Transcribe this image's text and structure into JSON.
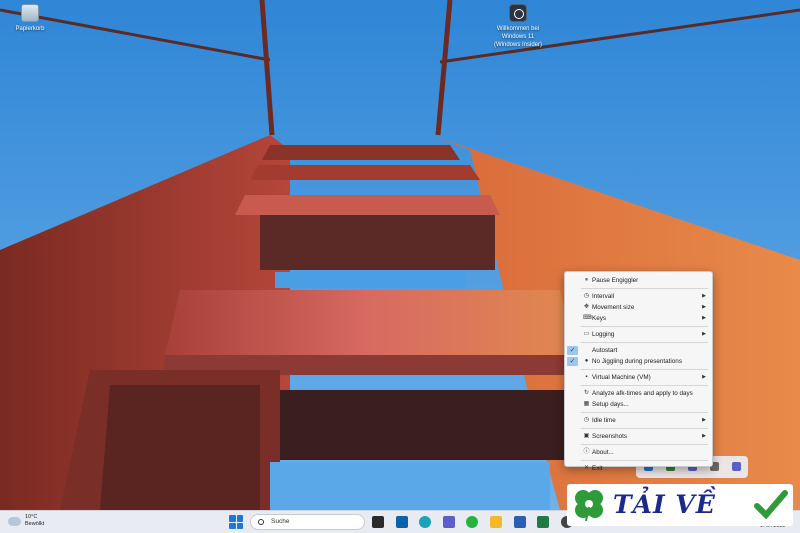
{
  "desktop": {
    "icons": [
      {
        "name": "Papierkorb"
      },
      {
        "name": "Willkommen bei Windows 11 (Windows Insider)"
      }
    ]
  },
  "context_menu": {
    "items": [
      {
        "label": "Pause Engiggler",
        "icon": "pause-icon"
      },
      {
        "label": "Intervall",
        "icon": "clock-icon",
        "submenu": true
      },
      {
        "label": "Movement size",
        "icon": "move-icon",
        "submenu": true
      },
      {
        "label": "Keys",
        "icon": "keyboard-icon",
        "submenu": true
      },
      {
        "label": "Logging",
        "icon": "folder-icon",
        "submenu": true
      },
      {
        "label": "Autostart",
        "checked": true
      },
      {
        "label": "No Jiggling during presentations",
        "checked": true,
        "icon": "presentation-icon"
      },
      {
        "label": "Virtual Machine (VM)",
        "icon": "monitor-icon",
        "submenu": true
      },
      {
        "label": "Analyze afk-times and apply to days",
        "icon": "analyze-icon"
      },
      {
        "label": "Setup days...",
        "icon": "calendar-icon"
      },
      {
        "label": "Idle time",
        "icon": "clock-icon",
        "submenu": true
      },
      {
        "label": "Screenshots",
        "icon": "screenshot-icon",
        "submenu": true
      },
      {
        "label": "About...",
        "icon": "info-icon"
      },
      {
        "label": "Exit",
        "icon": "close-icon"
      }
    ]
  },
  "watermark": {
    "text": "TẢI VỀ"
  },
  "taskbar": {
    "weather_temp": "10°C",
    "weather_desc": "Bewölkt",
    "search_placeholder": "Suche",
    "date": "17.04.2023"
  },
  "colors": {
    "sky": "#3a8ad8",
    "bridge": "#c8553a",
    "menu_bg": "#f6f6f6",
    "check_bg": "#9cc6ea",
    "watermark_text": "#1a2a8c",
    "accent": "#1b78d4"
  }
}
